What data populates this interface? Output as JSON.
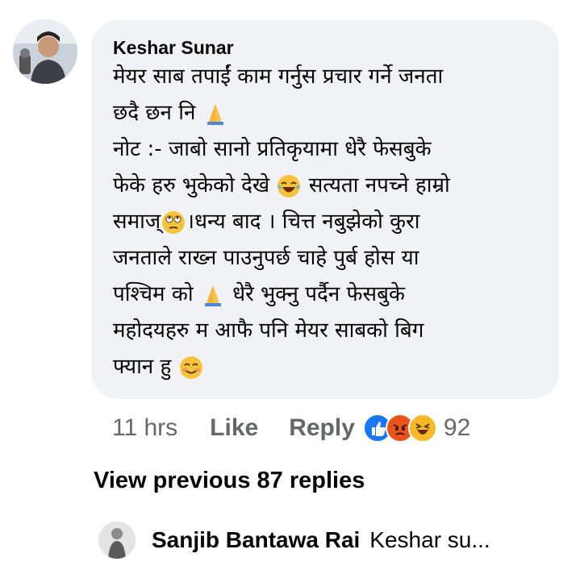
{
  "comment": {
    "author": "Keshar Sunar",
    "lines": [
      "मेयर साब तपाईं काम गर्नुस प्रचार गर्ने जनता",
      "छदै छन नि",
      "नोट :- जाबो सानो प्रतिकृयामा धेरै फेसबुके",
      "फेके हरु भुकेको देखे",
      "सत्यता नपच्ने हाम्रो",
      "समाज्",
      "।धन्य बाद । चित्त नबुझेको कुरा",
      "जनताले राख्न पाउनुपर्छ चाहे पुर्ब होस या",
      "पश्चिम को",
      "धेरै भुक्नु पर्दैन फेसबुके",
      "महोदयहरु  म आफै पनि मेयर साबको बिग",
      "फ्यान हु"
    ],
    "emoji": {
      "pray": "folded-hands-emoji",
      "laugh": "tears-of-joy-emoji",
      "eyeroll": "eye-roll-emoji",
      "smile": "smiling-face-emoji"
    }
  },
  "actions": {
    "time": "11 hrs",
    "like": "Like",
    "reply": "Reply",
    "reaction_count": "92",
    "reaction_icons": [
      "like-reaction-icon",
      "angry-reaction-icon",
      "haha-reaction-icon"
    ],
    "colors": {
      "like": "#1877f2",
      "angry": "#e8541c",
      "haha": "#f7b928"
    }
  },
  "view_previous": "View previous 87 replies",
  "reply": {
    "author": "Sanjib Bantawa Rai",
    "preview": "Keshar su..."
  }
}
